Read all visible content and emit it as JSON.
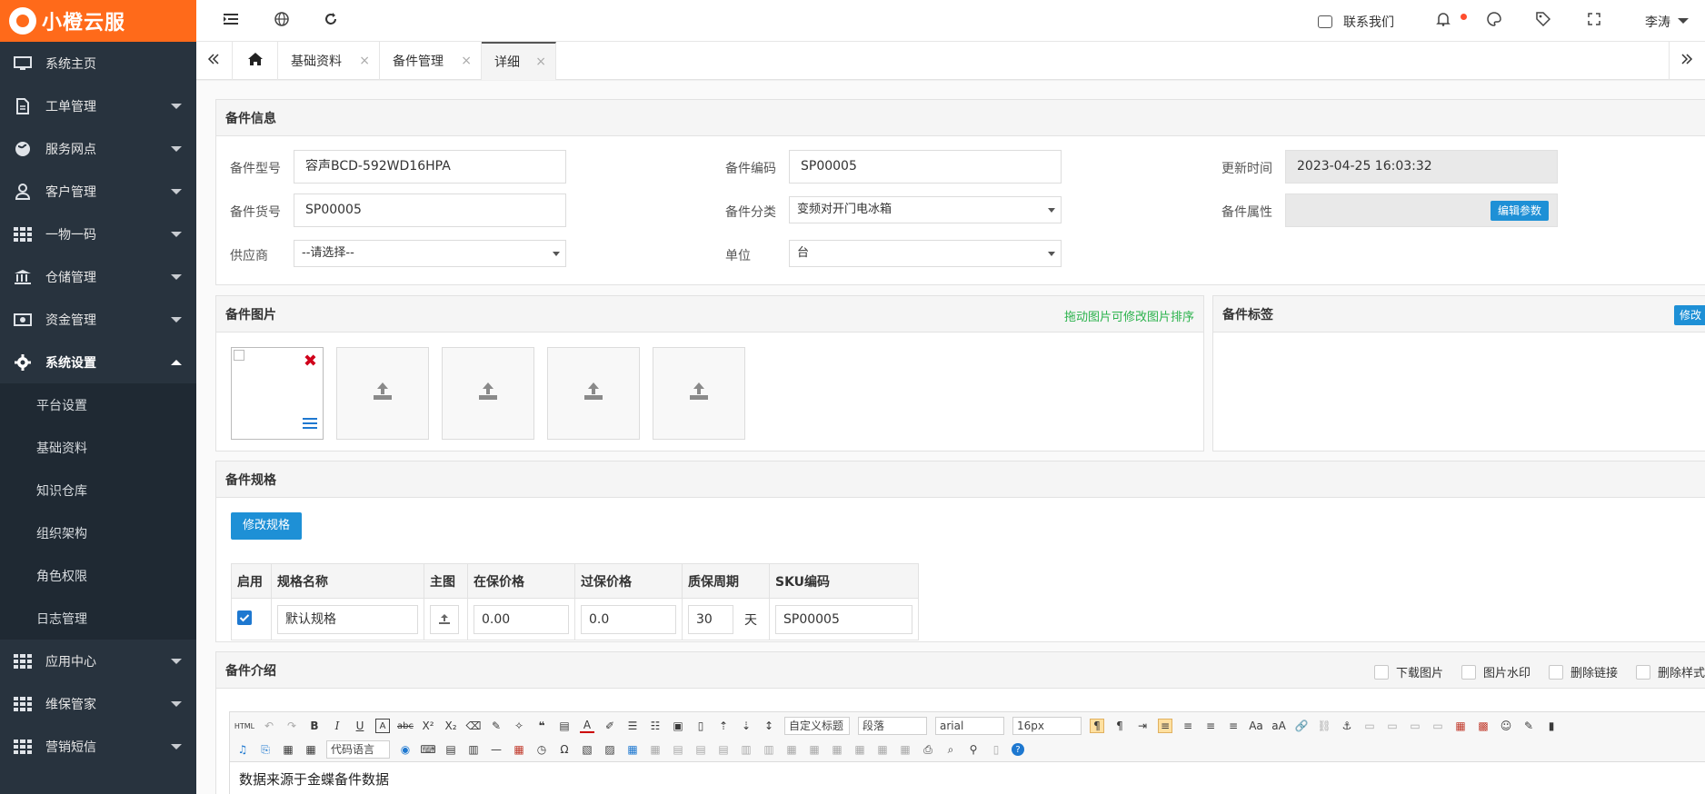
{
  "app": {
    "logo_text": "小橙云服"
  },
  "sidebar": {
    "items": [
      {
        "label": "系统主页",
        "icon": "monitor-icon"
      },
      {
        "label": "工单管理",
        "icon": "document-icon"
      },
      {
        "label": "服务网点",
        "icon": "globe-icon"
      },
      {
        "label": "客户管理",
        "icon": "user-icon"
      },
      {
        "label": "一物一码",
        "icon": "grid-icon"
      },
      {
        "label": "仓储管理",
        "icon": "bank-icon"
      },
      {
        "label": "资金管理",
        "icon": "money-icon"
      },
      {
        "label": "系统设置",
        "icon": "gear-icon"
      }
    ],
    "sub_items": [
      "平台设置",
      "基础资料",
      "知识仓库",
      "组织架构",
      "角色权限",
      "日志管理"
    ],
    "bottom_items": [
      {
        "label": "应用中心",
        "icon": "grid-icon"
      },
      {
        "label": "维保管家",
        "icon": "grid-icon"
      },
      {
        "label": "营销短信",
        "icon": "grid-icon"
      }
    ]
  },
  "topbar": {
    "contact_label": "联系我们",
    "user_name": "李涛"
  },
  "tabs": [
    {
      "label": "基础资料"
    },
    {
      "label": "备件管理"
    },
    {
      "label": "详细"
    }
  ],
  "info": {
    "title": "备件信息",
    "model_label": "备件型号",
    "model_value": "容声BCD-592WD16HPA",
    "code_label": "备件编码",
    "code_value": "SP00005",
    "updated_label": "更新时间",
    "updated_value": "2023-04-25 16:03:32",
    "sku_label": "备件货号",
    "sku_value": "SP00005",
    "category_label": "备件分类",
    "category_value": "变频对开门电冰箱",
    "attr_label": "备件属性",
    "attr_button": "编辑参数",
    "supplier_label": "供应商",
    "supplier_value": "--请选择--",
    "unit_label": "单位",
    "unit_value": "台"
  },
  "images": {
    "title": "备件图片",
    "tip": "拖动图片可修改图片排序"
  },
  "tags": {
    "title": "备件标签",
    "edit_button": "修改"
  },
  "spec": {
    "title": "备件规格",
    "edit_button": "修改规格",
    "headers": [
      "启用",
      "规格名称",
      "主图",
      "在保价格",
      "过保价格",
      "质保周期",
      "SKU编码"
    ],
    "row": {
      "enabled": true,
      "name": "默认规格",
      "in_price": "0.00",
      "out_price": "0.0",
      "period": "30",
      "period_unit": "天",
      "sku": "SP00005"
    }
  },
  "intro": {
    "title": "备件介绍",
    "options": [
      "下载图片",
      "图片水印",
      "删除链接",
      "删除样式"
    ],
    "toolbar": {
      "custom_title": "自定义标题",
      "paragraph": "段落",
      "font": "arial",
      "size": "16px",
      "code_lang": "代码语言"
    },
    "body_text": "数据来源于金蝶备件数据"
  },
  "colors": {
    "accent": "#ff6a1a",
    "sidebar": "#28333e",
    "button": "#1e90d6",
    "tip": "#2bb24c"
  }
}
